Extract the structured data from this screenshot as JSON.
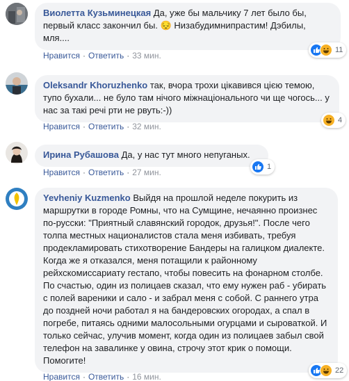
{
  "comments": [
    {
      "author": "Виолетта Кузьминецкая",
      "text": "Да, уже бы мальчику 7 лет было бы, первый класс закончил бы. 😔 Низабудимнипрастим! Дэбилы, мля....",
      "like_label": "Нравится",
      "reply_label": "Ответить",
      "time": "33 мин.",
      "reaction_count": "11",
      "reactions": [
        "like-icon",
        "haha-icon"
      ]
    },
    {
      "author": "Oleksandr Khoruzhenko",
      "text": "так, вчора трохи цікавився цією темою, тупо бухали... не було там нічого міжнаціонального чи ще чогось... у нас за такі речі рти не рвуть:-))",
      "like_label": "Нравится",
      "reply_label": "Ответить",
      "time": "32 мин.",
      "reaction_count": "4",
      "reactions": [
        "haha-icon"
      ]
    },
    {
      "author": "Ирина Рубашова",
      "text": "Да, у нас тут много непуганых.",
      "like_label": "Нравится",
      "reply_label": "Ответить",
      "time": "27 мин.",
      "reaction_count": "1",
      "reactions": [
        "like-icon"
      ]
    },
    {
      "author": "Yevheniy Kuzmenko",
      "text": "Выйдя на прошлой неделе покурить из маршрутки в городе Ромны, что на Сумщине, нечаянно произнес по-русски: \"Приятный славянский городок, друзья!\". После чего толпа местных националистов стала меня избивать, требуя продекламировать стихотворение Бандеры на галицком диалекте. Когда же я отказался, меня потащили к районному рейхскомиссариату гестапо, чтобы повесить на фонарном столбе. По счастью, один из полицаев сказал, что ему нужен раб - убирать с полей вареники и сало - и забрал меня с собой. С раннего утра до поздней ночи работал я на бандеровских огородах, а спал в погребе, питаясь одними малосольными огурцами и сыроваткой. И только сейчас, улучив момент, когда один из полицаев забыл свой телефон на завалинке у овина, строчу этот крик о помощи. Помогите!",
      "like_label": "Нравится",
      "reply_label": "Ответить",
      "time": "16 мин.",
      "reaction_count": "22",
      "reactions": [
        "like-icon",
        "haha-icon"
      ]
    }
  ],
  "colors": {
    "author": "#385898",
    "bubble": "#f2f3f5",
    "like": "#1877f2",
    "haha": "#f7b125",
    "meta": "#90949c"
  }
}
